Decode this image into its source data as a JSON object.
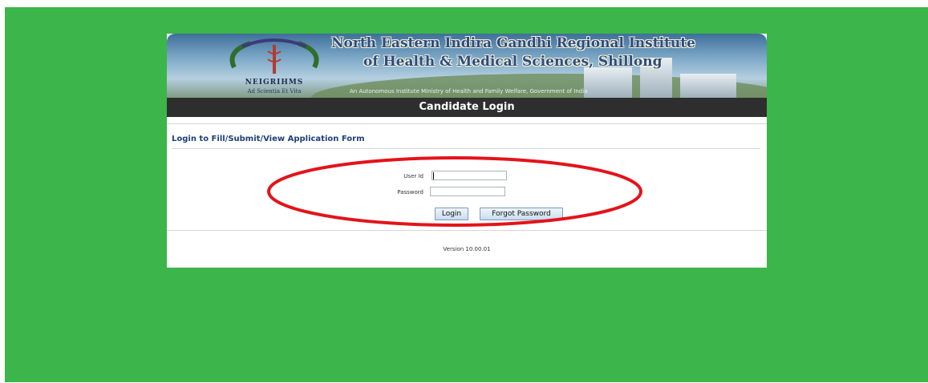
{
  "banner": {
    "institute_line1": "North Eastern Indira Gandhi Regional Institute",
    "institute_line2": "of Health & Medical Sciences, Shillong",
    "subtitle": "An Autonomous Institute Ministry of Health and Family Welfare, Government of India",
    "logo_name": "NEIGRIHMS",
    "logo_motto": "Ad Scientia Et Vita",
    "logo_icon": "caduceus-emblem-icon"
  },
  "header_bar": {
    "title": "Candidate Login"
  },
  "form": {
    "heading": "Login to Fill/Submit/View Application Form",
    "userid_label": "User Id",
    "userid_value": "",
    "password_label": "Password",
    "password_value": "",
    "login_label": "Login",
    "forgot_label": "Forgot Password"
  },
  "footer": {
    "version": "Version 10.00.01"
  },
  "colors": {
    "page_background": "#3cb54a",
    "header_bar": "#2e2e2e",
    "heading_text": "#1f3e78",
    "annotation_ellipse": "#e3131b"
  }
}
